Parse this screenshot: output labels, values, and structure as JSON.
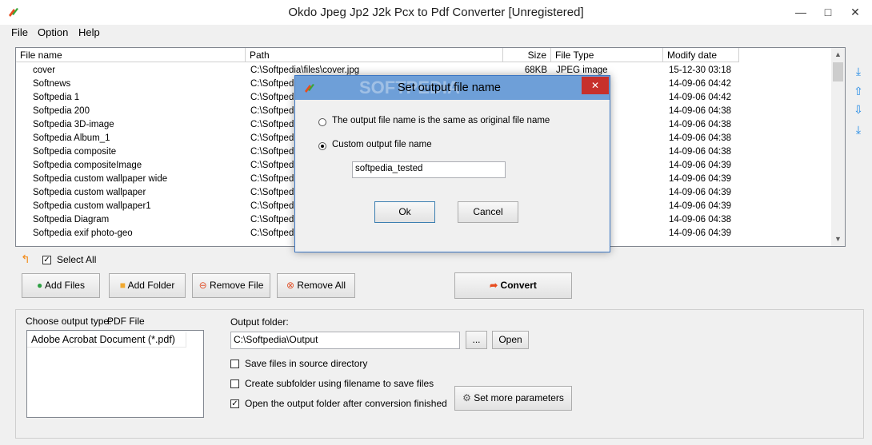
{
  "window": {
    "title": "Okdo Jpeg Jp2 J2k Pcx to Pdf Converter [Unregistered]"
  },
  "menu": [
    "File",
    "Option",
    "Help"
  ],
  "table": {
    "columns": [
      "File name",
      "Path",
      "Size",
      "File Type",
      "Modify date"
    ],
    "rows": [
      {
        "name": "cover",
        "path": "C:\\Softpedia\\files\\cover.jpg",
        "size": "68KB",
        "type": "JPEG image",
        "date": "15-12-30 03:18"
      },
      {
        "name": "Softnews",
        "path": "C:\\Softpedi",
        "size": "",
        "type": "",
        "date": "14-09-06 04:42"
      },
      {
        "name": "Softpedia 1",
        "path": "C:\\Softpedi",
        "size": "",
        "type": "",
        "date": "14-09-06 04:42"
      },
      {
        "name": "Softpedia 200",
        "path": "C:\\Softpedi",
        "size": "",
        "type": "",
        "date": "14-09-06 04:38"
      },
      {
        "name": "Softpedia 3D-image",
        "path": "C:\\Softpedi",
        "size": "",
        "type": "",
        "date": "14-09-06 04:38"
      },
      {
        "name": "Softpedia Album_1",
        "path": "C:\\Softpedi",
        "size": "",
        "type": "",
        "date": "14-09-06 04:38"
      },
      {
        "name": "Softpedia composite",
        "path": "C:\\Softpedi",
        "size": "",
        "type": "",
        "date": "14-09-06 04:38"
      },
      {
        "name": "Softpedia compositeImage",
        "path": "C:\\Softpedi",
        "size": "",
        "type": "",
        "date": "14-09-06 04:39"
      },
      {
        "name": "Softpedia custom wallpaper wide",
        "path": "C:\\Softpedi",
        "size": "",
        "type": "",
        "date": "14-09-06 04:39"
      },
      {
        "name": "Softpedia custom wallpaper",
        "path": "C:\\Softpedi",
        "size": "",
        "type": "",
        "date": "14-09-06 04:39"
      },
      {
        "name": "Softpedia custom wallpaper1",
        "path": "C:\\Softpedi",
        "size": "",
        "type": "",
        "date": "14-09-06 04:39"
      },
      {
        "name": "Softpedia Diagram",
        "path": "C:\\Softpedi",
        "size": "",
        "type": "",
        "date": "14-09-06 04:38"
      },
      {
        "name": "Softpedia exif photo-geo",
        "path": "C:\\Softpedi",
        "size": "",
        "type": "",
        "date": "14-09-06 04:39"
      }
    ]
  },
  "toolbar": {
    "select_all": "Select All",
    "add_files": "Add Files",
    "add_folder": "Add Folder",
    "remove_file": "Remove File",
    "remove_all": "Remove All",
    "convert": "Convert"
  },
  "output": {
    "type_label": "Choose output type:",
    "type_value": "PDF File",
    "type_options": [
      "Adobe Acrobat Document (*.pdf)"
    ],
    "folder_label": "Output folder:",
    "folder_value": "C:\\Softpedia\\Output",
    "browse": "...",
    "open": "Open",
    "save_in_source": "Save files in source directory",
    "create_subfolder": "Create subfolder using filename to save files",
    "open_after": "Open the output folder after conversion finished",
    "set_more": "Set more parameters"
  },
  "dialog": {
    "title": "Set output file name",
    "option_same": "The output file name is the same as original file name",
    "option_custom": "Custom output file name",
    "custom_value": "softpedia_tested",
    "ok": "Ok",
    "cancel": "Cancel"
  },
  "watermark": "SOFTPEDIA"
}
